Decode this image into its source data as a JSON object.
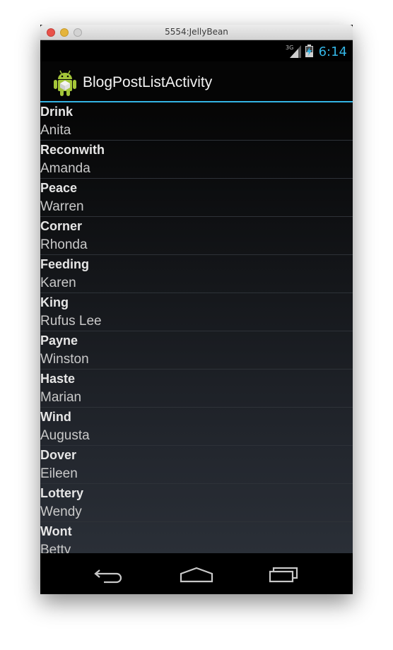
{
  "window": {
    "title": "5554:JellyBean"
  },
  "status_bar": {
    "time": "6:14",
    "network": "3G",
    "accent": "#33b5e5"
  },
  "action_bar": {
    "title": "BlogPostListActivity",
    "icon": "android-icon"
  },
  "posts": [
    {
      "title": "Drink",
      "author": "Anita"
    },
    {
      "title": "Reconwith",
      "author": "Amanda"
    },
    {
      "title": "Peace",
      "author": "Warren"
    },
    {
      "title": "Corner",
      "author": "Rhonda"
    },
    {
      "title": "Feeding",
      "author": "Karen"
    },
    {
      "title": "King",
      "author": "Rufus Lee"
    },
    {
      "title": "Payne",
      "author": "Winston"
    },
    {
      "title": "Haste",
      "author": "Marian"
    },
    {
      "title": "Wind",
      "author": "Augusta"
    },
    {
      "title": "Dover",
      "author": "Eileen"
    },
    {
      "title": "Lottery",
      "author": "Wendy"
    },
    {
      "title": "Wont",
      "author": "Betty"
    }
  ],
  "nav_bar": {
    "buttons": [
      "back-icon",
      "home-icon",
      "recent-apps-icon"
    ]
  }
}
